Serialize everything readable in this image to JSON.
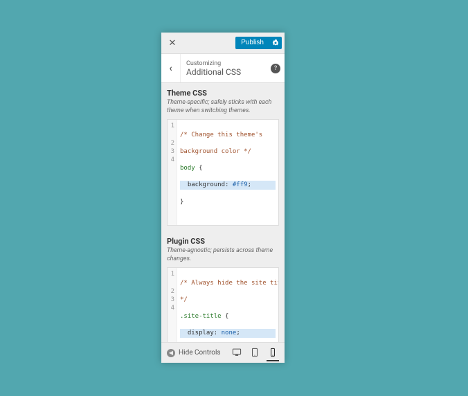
{
  "top": {
    "publish_label": "Publish"
  },
  "header": {
    "customizing": "Customizing",
    "title": "Additional CSS"
  },
  "theme": {
    "heading": "Theme CSS",
    "desc": "Theme-specific; safely sticks with each theme when switching themes.",
    "lines": {
      "l1": "/* Change this theme's",
      "l1b": "background color */",
      "l2a": "body",
      "l2b": " {",
      "l3a": "  background",
      "l3b": ": ",
      "l3c": "#ff9",
      "l3d": ";",
      "l4": "}"
    },
    "nums": {
      "n1": "1",
      "n2": "2",
      "n3": "3",
      "n4": "4"
    }
  },
  "plugin": {
    "heading": "Plugin CSS",
    "desc": "Theme-agnostic; persists across theme changes.",
    "lines": {
      "l1": "/* Always hide the site title",
      "l1b": "*/",
      "l2a": ".site-title",
      "l2b": " {",
      "l3a": "  display",
      "l3b": ": ",
      "l3c": "none",
      "l3d": ";",
      "l4": "}"
    },
    "nums": {
      "n1": "1",
      "n2": "2",
      "n3": "3",
      "n4": "4"
    }
  },
  "footer": {
    "hide_controls": "Hide Controls"
  }
}
